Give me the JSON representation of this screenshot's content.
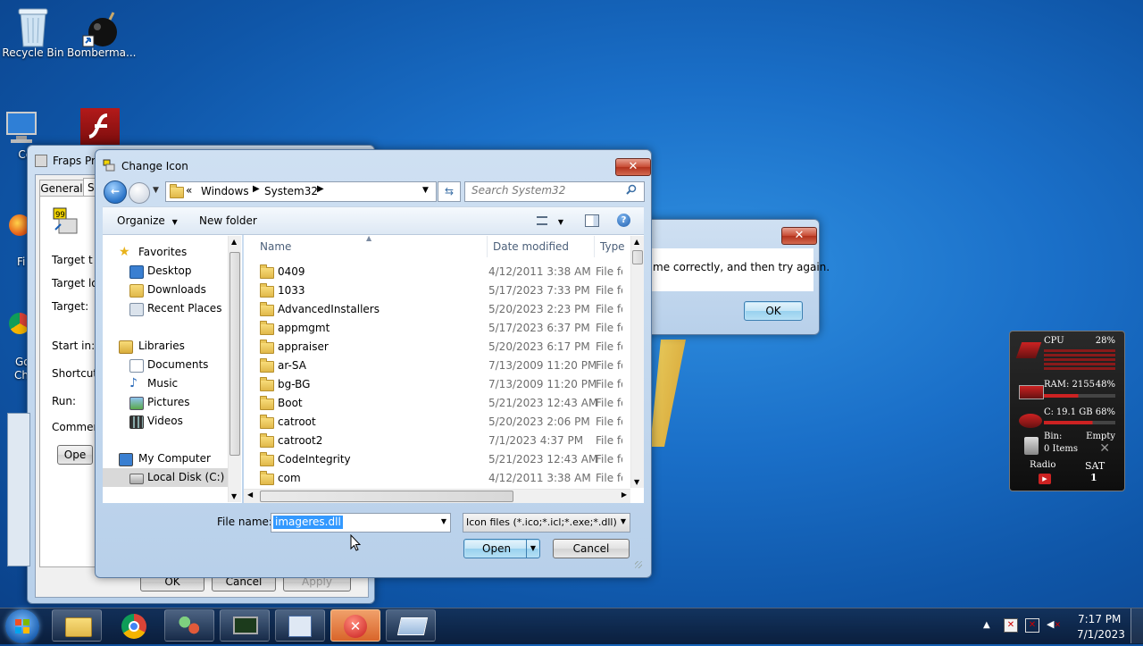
{
  "desktop": {
    "recycle_bin": "Recycle Bin",
    "bomberman": "Bomberma...",
    "computer_partial": "Con",
    "firefox_partial": "Fi",
    "chrome_partial_1": "Go",
    "chrome_partial_2": "Ch"
  },
  "fraps_window": {
    "title": "Fraps Pro",
    "tab_general": "General",
    "tab_s": "S",
    "labels": [
      "Target t",
      "Target lo",
      "Target:",
      "Start in:",
      "Shortcut",
      "Run:",
      "Comment"
    ],
    "open_button": "Ope",
    "ok": "OK",
    "cancel": "Cancel",
    "apply": "Apply"
  },
  "error_window": {
    "message": "me correctly, and then try again.",
    "ok": "OK"
  },
  "dialog": {
    "title": "Change Icon",
    "breadcrumb": [
      "Windows",
      "System32"
    ],
    "breadcrumb_prefix": "«",
    "search_placeholder": "Search System32",
    "organize": "Organize",
    "new_folder": "New folder",
    "nav": {
      "favorites": "Favorites",
      "desktop": "Desktop",
      "downloads": "Downloads",
      "recent_places": "Recent Places",
      "libraries": "Libraries",
      "documents": "Documents",
      "music": "Music",
      "pictures": "Pictures",
      "videos": "Videos",
      "my_computer": "My Computer",
      "local_disk": "Local Disk (C:)"
    },
    "columns": {
      "name": "Name",
      "date": "Date modified",
      "type": "Type"
    },
    "files": [
      {
        "name": "0409",
        "date": "4/12/2011 3:38 AM",
        "type": "File fol"
      },
      {
        "name": "1033",
        "date": "5/17/2023 7:33 PM",
        "type": "File fol"
      },
      {
        "name": "AdvancedInstallers",
        "date": "5/20/2023 2:23 PM",
        "type": "File fol"
      },
      {
        "name": "appmgmt",
        "date": "5/17/2023 6:37 PM",
        "type": "File fol"
      },
      {
        "name": "appraiser",
        "date": "5/20/2023 6:17 PM",
        "type": "File fol"
      },
      {
        "name": "ar-SA",
        "date": "7/13/2009 11:20 PM",
        "type": "File fol"
      },
      {
        "name": "bg-BG",
        "date": "7/13/2009 11:20 PM",
        "type": "File fol"
      },
      {
        "name": "Boot",
        "date": "5/21/2023 12:43 AM",
        "type": "File fol"
      },
      {
        "name": "catroot",
        "date": "5/20/2023 2:06 PM",
        "type": "File fol"
      },
      {
        "name": "catroot2",
        "date": "7/1/2023 4:37 PM",
        "type": "File fol"
      },
      {
        "name": "CodeIntegrity",
        "date": "5/21/2023 12:43 AM",
        "type": "File fol"
      },
      {
        "name": "com",
        "date": "4/12/2011 3:38 AM",
        "type": "File fol"
      }
    ],
    "file_name_label": "File name:",
    "file_name_value": "imageres.dll",
    "file_type": "Icon files (*.ico;*.icl;*.exe;*.dll)",
    "open": "Open",
    "cancel": "Cancel"
  },
  "gadget": {
    "cpu_label": "CPU",
    "cpu_value": "28%",
    "ram_label": "RAM: 2155",
    "ram_value": "48%",
    "disk_label": "C:",
    "disk_value": "19.1 GB 68%",
    "bin_label": "Bin:",
    "bin_value": "Empty",
    "bin_items": "0 Items",
    "radio": "Radio",
    "day": "SAT",
    "date_num": "1"
  },
  "taskbar": {
    "time": "7:17 PM",
    "date": "7/1/2023"
  },
  "colors": {
    "accent": "#3399ff",
    "close_red": "#c74a32",
    "selection": "#3399ff"
  }
}
